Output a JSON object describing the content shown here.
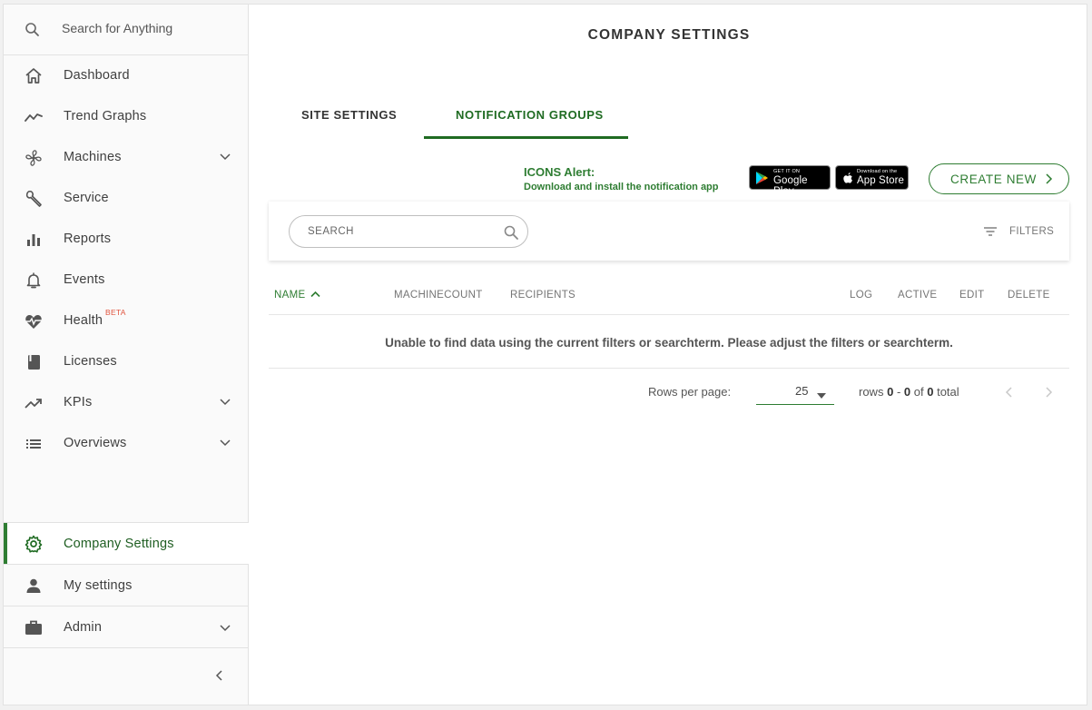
{
  "search": {
    "placeholder": "Search for Anything"
  },
  "sidebar": {
    "items": [
      {
        "label": "Dashboard",
        "icon": "home-icon"
      },
      {
        "label": "Trend Graphs",
        "icon": "trend-line-icon"
      },
      {
        "label": "Machines",
        "icon": "fan-icon",
        "expandable": true
      },
      {
        "label": "Service",
        "icon": "wrench-icon"
      },
      {
        "label": "Reports",
        "icon": "bar-chart-icon"
      },
      {
        "label": "Events",
        "icon": "bell-icon"
      },
      {
        "label": "Health",
        "icon": "heart-pulse-icon",
        "badge": "BETA"
      },
      {
        "label": "Licenses",
        "icon": "book-icon"
      },
      {
        "label": "KPIs",
        "icon": "trending-up-icon",
        "expandable": true
      },
      {
        "label": "Overviews",
        "icon": "list-icon",
        "expandable": true
      }
    ],
    "bottom": [
      {
        "label": "Company Settings",
        "icon": "gear-icon",
        "active": true
      },
      {
        "label": "My settings",
        "icon": "person-icon"
      },
      {
        "label": "Admin",
        "icon": "briefcase-icon",
        "expandable": true
      }
    ]
  },
  "colors": {
    "accent": "#2e7d32",
    "accent_dark": "#1f6b22",
    "beta": "#e0533d"
  },
  "main": {
    "title": "COMPANY SETTINGS",
    "tabs": [
      {
        "label": "SITE SETTINGS",
        "active": false
      },
      {
        "label": "NOTIFICATION GROUPS",
        "active": true
      }
    ],
    "alert": {
      "title": "ICONS Alert:",
      "subtitle": "Download and install the notification app"
    },
    "stores": {
      "google_small": "GET IT ON",
      "google_big": "Google Play",
      "apple_small": "Download on the",
      "apple_big": "App Store"
    },
    "create_label": "CREATE NEW",
    "search_placeholder": "SEARCH",
    "filters_label": "FILTERS",
    "table": {
      "columns": [
        "NAME",
        "MACHINECOUNT",
        "RECIPIENTS",
        "LOG",
        "ACTIVE",
        "EDIT",
        "DELETE"
      ],
      "empty_message": "Unable to find data using the current filters or searchterm. Please adjust the filters or searchterm."
    },
    "pagination": {
      "rows_per_page_label": "Rows per page:",
      "rows_per_page": "25",
      "rows_word": "rows",
      "from": "0",
      "sep": "-",
      "to": "0",
      "of_word": "of",
      "total": "0",
      "total_word": "total"
    }
  }
}
